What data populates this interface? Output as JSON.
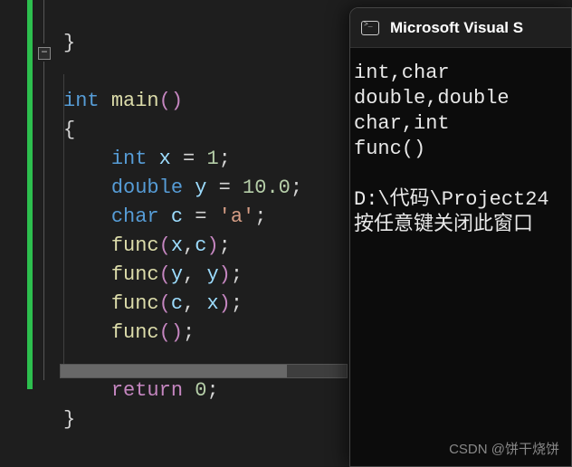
{
  "editor": {
    "close_brace_top": "}",
    "fn_sig": {
      "int": "int",
      "main": "main",
      "lp": "(",
      "rp": ")"
    },
    "open_brace": "{",
    "decl_x": {
      "int": "int",
      "name": "x",
      "eq": "=",
      "val": "1",
      "semi": ";"
    },
    "decl_y": {
      "double": "double",
      "name": "y",
      "eq": "=",
      "val": "10.0",
      "semi": ";"
    },
    "decl_c": {
      "char": "char",
      "name": "c",
      "eq": "=",
      "val": "'a'",
      "semi": ";"
    },
    "call1": {
      "fn": "func",
      "lp": "(",
      "a1": "x",
      "comma": ",",
      "a2": "c",
      "rp": ")",
      "semi": ";"
    },
    "call2": {
      "fn": "func",
      "lp": "(",
      "a1": "y",
      "comma": ",",
      "a2": "y",
      "rp": ")",
      "semi": ";"
    },
    "call3": {
      "fn": "func",
      "lp": "(",
      "a1": "c",
      "comma": ",",
      "a2": "x",
      "rp": ")",
      "semi": ";"
    },
    "call4": {
      "fn": "func",
      "lp": "(",
      "rp": ")",
      "semi": ";"
    },
    "ret": {
      "kw": "return",
      "val": "0",
      "semi": ";"
    },
    "close_brace": "}"
  },
  "console": {
    "title": "Microsoft Visual S",
    "lines": [
      "int,char",
      "double,double",
      "char,int",
      "func()",
      "",
      "D:\\代码\\Project24",
      "按任意键关闭此窗口"
    ]
  },
  "watermark": "CSDN @饼干烧饼"
}
